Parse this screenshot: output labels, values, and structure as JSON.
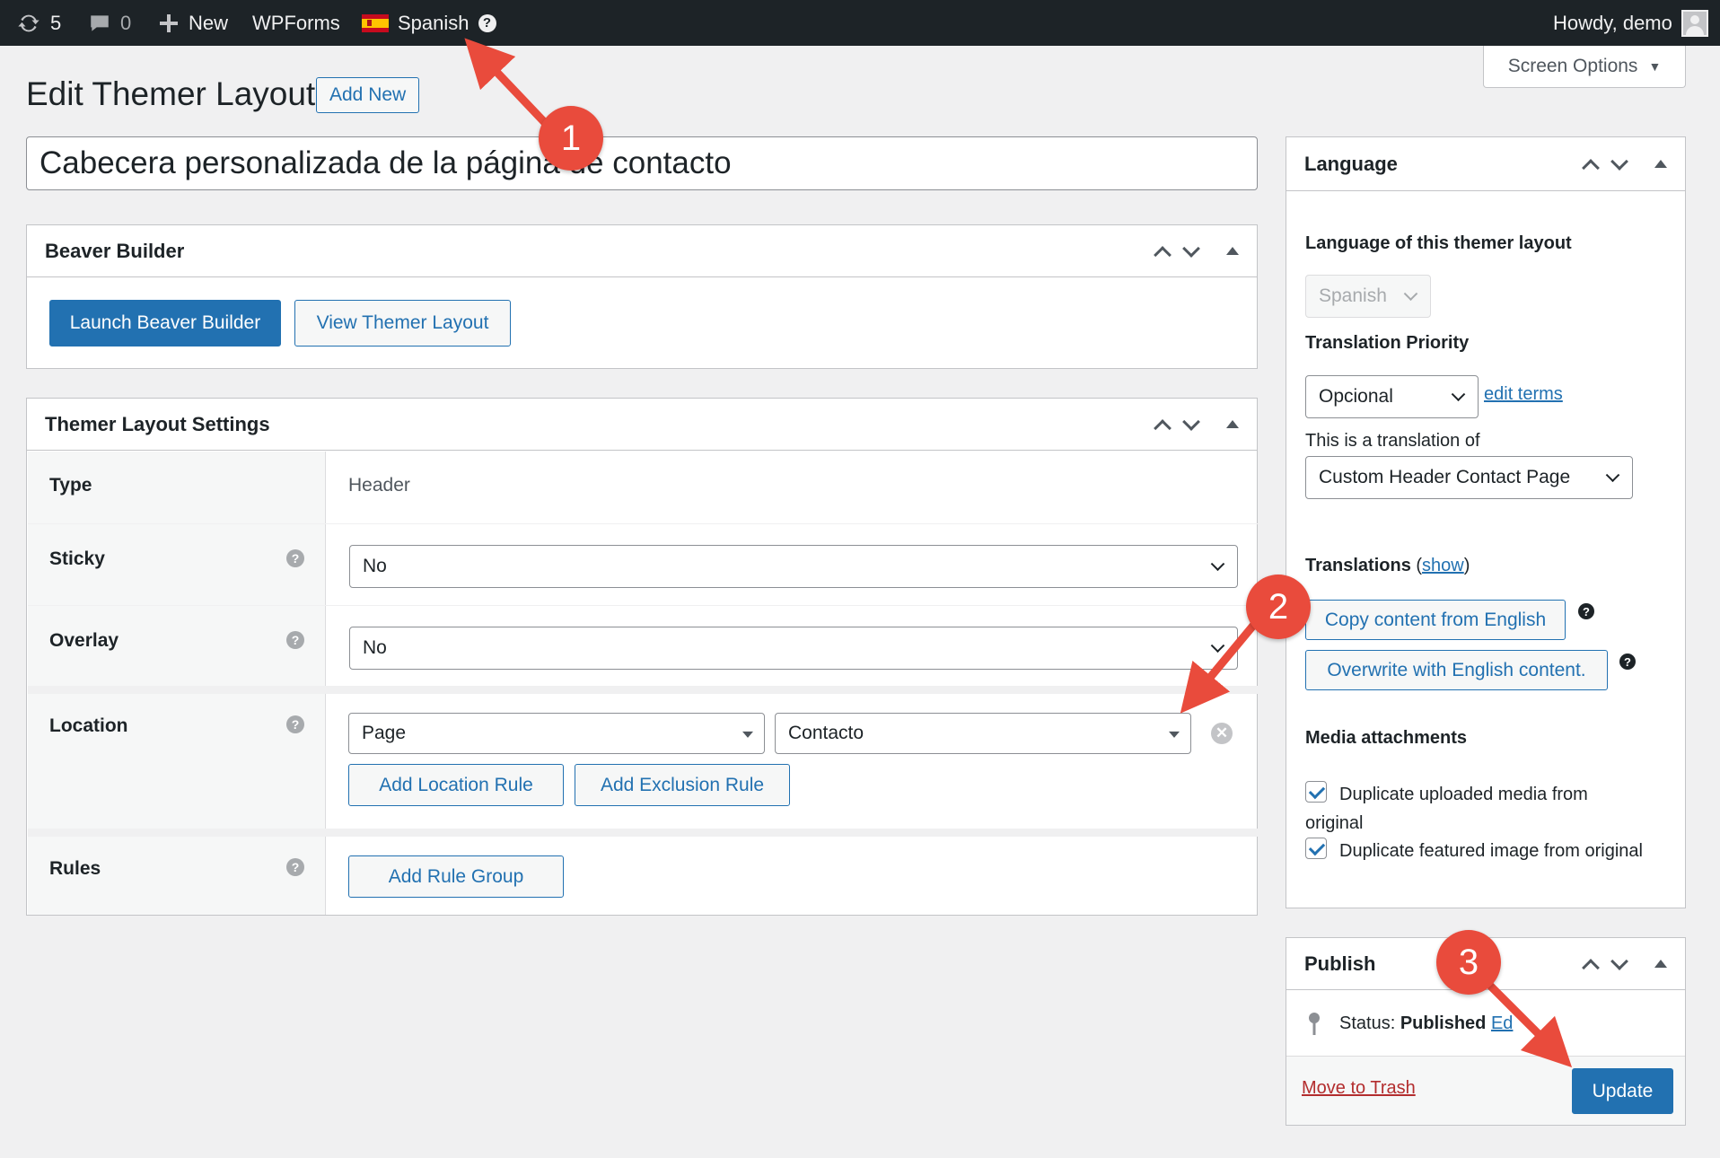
{
  "admin_bar": {
    "updates_count": "5",
    "comments_count": "0",
    "new_label": "New",
    "wpforms_label": "WPForms",
    "language_label": "Spanish",
    "help_glyph": "?",
    "howdy": "Howdy, demo"
  },
  "screen_options": {
    "label": "Screen Options",
    "arrow": "▼"
  },
  "page": {
    "title": "Edit Themer Layout",
    "add_new": "Add New",
    "post_title": "Cabecera personalizada de la página de contacto"
  },
  "beaver_builder": {
    "heading": "Beaver Builder",
    "launch_button": "Launch Beaver Builder",
    "view_button": "View Themer Layout"
  },
  "themer_settings": {
    "heading": "Themer Layout Settings",
    "type_label": "Type",
    "type_value": "Header",
    "sticky_label": "Sticky",
    "sticky_value": "No",
    "overlay_label": "Overlay",
    "overlay_value": "No",
    "location_label": "Location",
    "location_type": "Page",
    "location_value": "Contacto",
    "add_location_rule": "Add Location Rule",
    "add_exclusion_rule": "Add Exclusion Rule",
    "rules_label": "Rules",
    "add_rule_group": "Add Rule Group",
    "help_glyph": "?",
    "remove_glyph": "✕"
  },
  "language_box": {
    "heading": "Language",
    "language_of_layout": "Language of this themer layout",
    "language_value": "Spanish",
    "translation_priority": "Translation Priority",
    "priority_value": "Opcional",
    "edit_terms": "edit terms",
    "translation_of_label": "This is a translation of",
    "translation_of_value": "Custom Header Contact Page",
    "translations_label": "Translations",
    "show_link": "show",
    "copy_content_button": "Copy content from English",
    "overwrite_button": "Overwrite with English content.",
    "help_glyph": "?",
    "media_attachments": "Media attachments",
    "dup_media": "Duplicate uploaded media from original",
    "dup_featured": "Duplicate featured image from original"
  },
  "publish_box": {
    "heading": "Publish",
    "status_label": "Status:",
    "status_value": "Published",
    "edit_link": "Ed",
    "move_to_trash": "Move to Trash",
    "update_button": "Update"
  },
  "annotations": [
    "1",
    "2",
    "3"
  ],
  "colors": {
    "admin_bar_bg": "#1d2327",
    "accent": "#2271b1",
    "annotation": "#e94b3c",
    "trash": "#b32d2e"
  }
}
